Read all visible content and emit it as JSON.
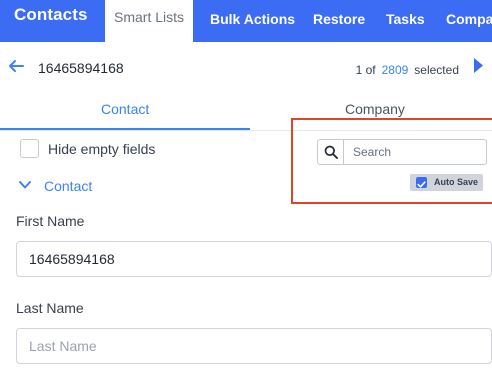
{
  "nav": {
    "title": "Contacts",
    "tabs": [
      "Smart Lists",
      "Bulk Actions",
      "Restore",
      "Tasks",
      "Compa"
    ]
  },
  "record": {
    "id": "16465894168",
    "pager_prefix": "1 of",
    "pager_count": "2809",
    "pager_suffix": "selected"
  },
  "tabs": {
    "contact": "Contact",
    "company": "Company"
  },
  "options": {
    "hide_empty_label": "Hide empty fields",
    "hide_empty_checked": false
  },
  "search": {
    "placeholder": "Search",
    "value": ""
  },
  "autosave": {
    "label": "Auto Save",
    "checked": true
  },
  "section": {
    "title": "Contact"
  },
  "fields": {
    "first_name": {
      "label": "First Name",
      "value": "16465894168"
    },
    "last_name": {
      "label": "Last Name",
      "placeholder": "Last Name",
      "value": ""
    }
  },
  "colors": {
    "primary": "#3b6cf3",
    "link": "#3b82f6",
    "highlight": "#e0452a"
  }
}
